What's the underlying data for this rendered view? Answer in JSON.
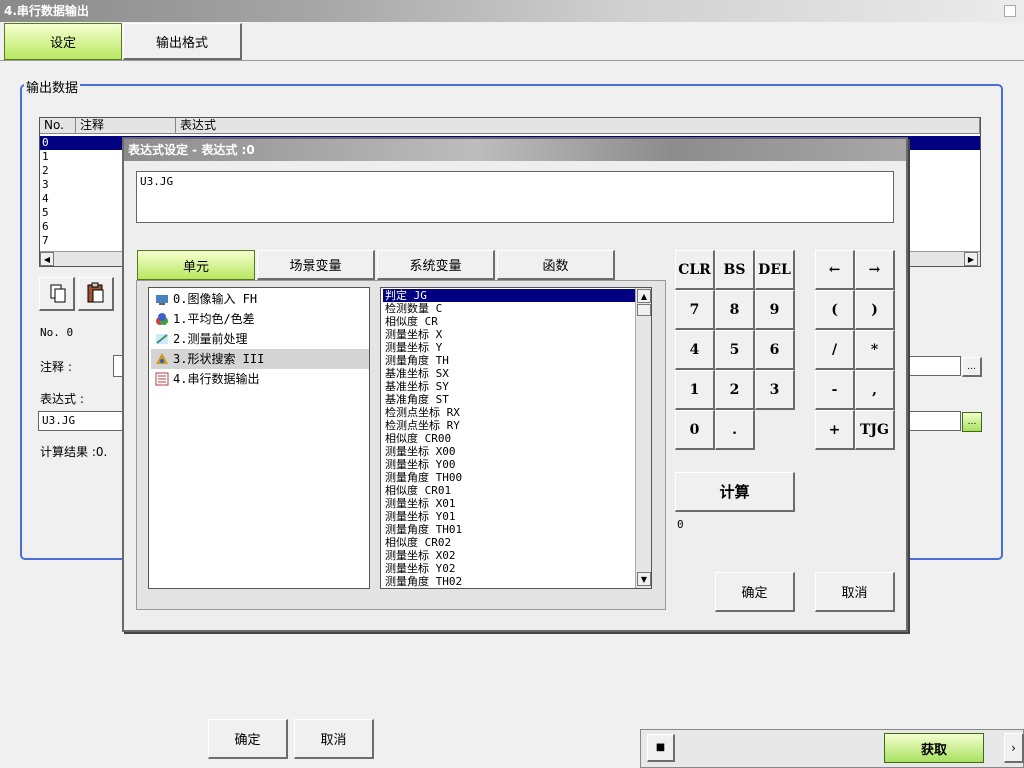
{
  "window": {
    "title": "4.串行数据输出"
  },
  "tabs": [
    {
      "label": "设定"
    },
    {
      "label": "输出格式"
    }
  ],
  "output_data": {
    "group_label": "输出数据",
    "columns": [
      "No.",
      "注释",
      "表达式"
    ],
    "rows": [
      "0",
      "1",
      "2",
      "3",
      "4",
      "5",
      "6",
      "7"
    ],
    "no_text": "No.  0",
    "comment_label": "注释 :",
    "expression_label": "表达式 :",
    "expression_value": "U3.JG",
    "calc_result": "计算结果 :0."
  },
  "bottom": {
    "ok": "确定",
    "cancel": "取消"
  },
  "status_bar": {
    "acquire": "获取"
  },
  "dialog": {
    "title": "表达式设定 - 表达式 :0",
    "expression": "U3.JG",
    "tabs": [
      {
        "label": "单元"
      },
      {
        "label": "场景变量"
      },
      {
        "label": "系统变量"
      },
      {
        "label": "函数"
      }
    ],
    "units": [
      {
        "label": "0.图像输入 FH",
        "icon": "camera-icon",
        "color": "#4a7fc0"
      },
      {
        "label": "1.平均色/色差",
        "icon": "color-icon",
        "color": "#d04040"
      },
      {
        "label": "2.测量前处理",
        "icon": "filter-icon",
        "color": "#3a9a60"
      },
      {
        "label": "3.形状搜索 III",
        "icon": "shape-search-icon",
        "color": "#d09a20"
      },
      {
        "label": "4.串行数据输出",
        "icon": "serial-output-icon",
        "color": "#b04040"
      }
    ],
    "variables": [
      "判定 JG",
      "检测数量 C",
      "相似度 CR",
      "测量坐标 X",
      "测量坐标 Y",
      "测量角度 TH",
      "基准坐标 SX",
      "基准坐标 SY",
      "基准角度 ST",
      "检测点坐标 RX",
      "检测点坐标 RY",
      "相似度 CR00",
      "测量坐标 X00",
      "测量坐标 Y00",
      "测量角度 TH00",
      "相似度 CR01",
      "测量坐标 X01",
      "测量坐标 Y01",
      "测量角度 TH01",
      "相似度 CR02",
      "测量坐标 X02",
      "测量坐标 Y02",
      "测量角度 TH02"
    ],
    "keypad": {
      "clr": "CLR",
      "bs": "BS",
      "del": "DEL",
      "n7": "7",
      "n8": "8",
      "n9": "9",
      "n4": "4",
      "n5": "5",
      "n6": "6",
      "n1": "1",
      "n2": "2",
      "n3": "3",
      "n0": "0",
      "dot": "."
    },
    "operators": {
      "left": "←",
      "right": "→",
      "lparen": "(",
      "rparen": ")",
      "div": "/",
      "mul": "*",
      "minus": "-",
      "comma": ",",
      "plus": "+",
      "tjg": "TJG"
    },
    "calc_label": "计算",
    "calc_result": "0",
    "ok": "确定",
    "cancel": "取消"
  },
  "colors": {
    "selection": "#000080",
    "accent_green": "#b8e860",
    "group_border": "#4b6ed8"
  }
}
